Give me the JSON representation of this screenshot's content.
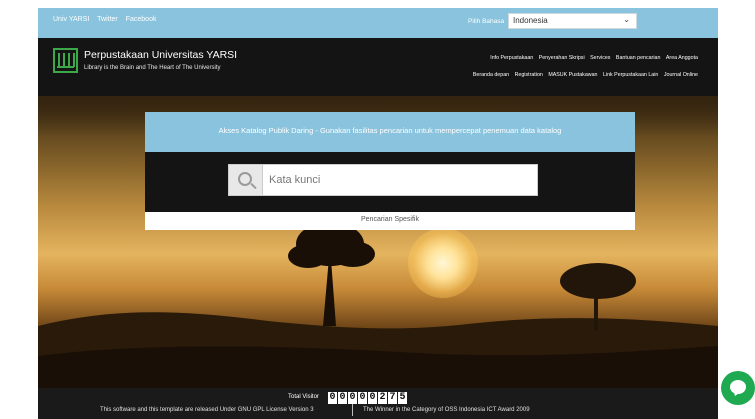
{
  "topbar": {
    "links": [
      "Univ YARSI",
      "Twitter",
      "Facebook"
    ],
    "lang_label": "Pilih Bahasa",
    "lang_value": "Indonesia"
  },
  "header": {
    "title": "Perpustakaan Universitas YARSI",
    "tagline": "Library is the Brain and The Heart of The University",
    "nav_row1": [
      "Info Perpustakaan",
      "Penyerahan Skripsi",
      "Services",
      "Bantuan pencarian",
      "Area Anggota"
    ],
    "nav_row2": [
      "Beranda depan",
      "Registration",
      "MASUK Pustakawan",
      "Link Perpustakaan Lain",
      "Journal Online"
    ]
  },
  "search": {
    "banner": "Akses Katalog Publik Daring - Gunakan fasilitas pencarian untuk mempercepat penemuan data katalog",
    "placeholder": "Kata kunci",
    "advanced": "Pencarian Spesifik"
  },
  "footer": {
    "visitor_label": "Total Visitor",
    "visitor_digits": [
      "0",
      "0",
      "0",
      "0",
      "0",
      "2",
      "7",
      "5"
    ],
    "license": "This software and this template are released Under GNU GPL License Version 3",
    "award": "The Winner in the Category of OSS Indonesia ICT Award 2009"
  },
  "colors": {
    "accent": "#89c3dd",
    "dark": "#141414",
    "logo": "#3da84a",
    "chat": "#1faa52"
  }
}
